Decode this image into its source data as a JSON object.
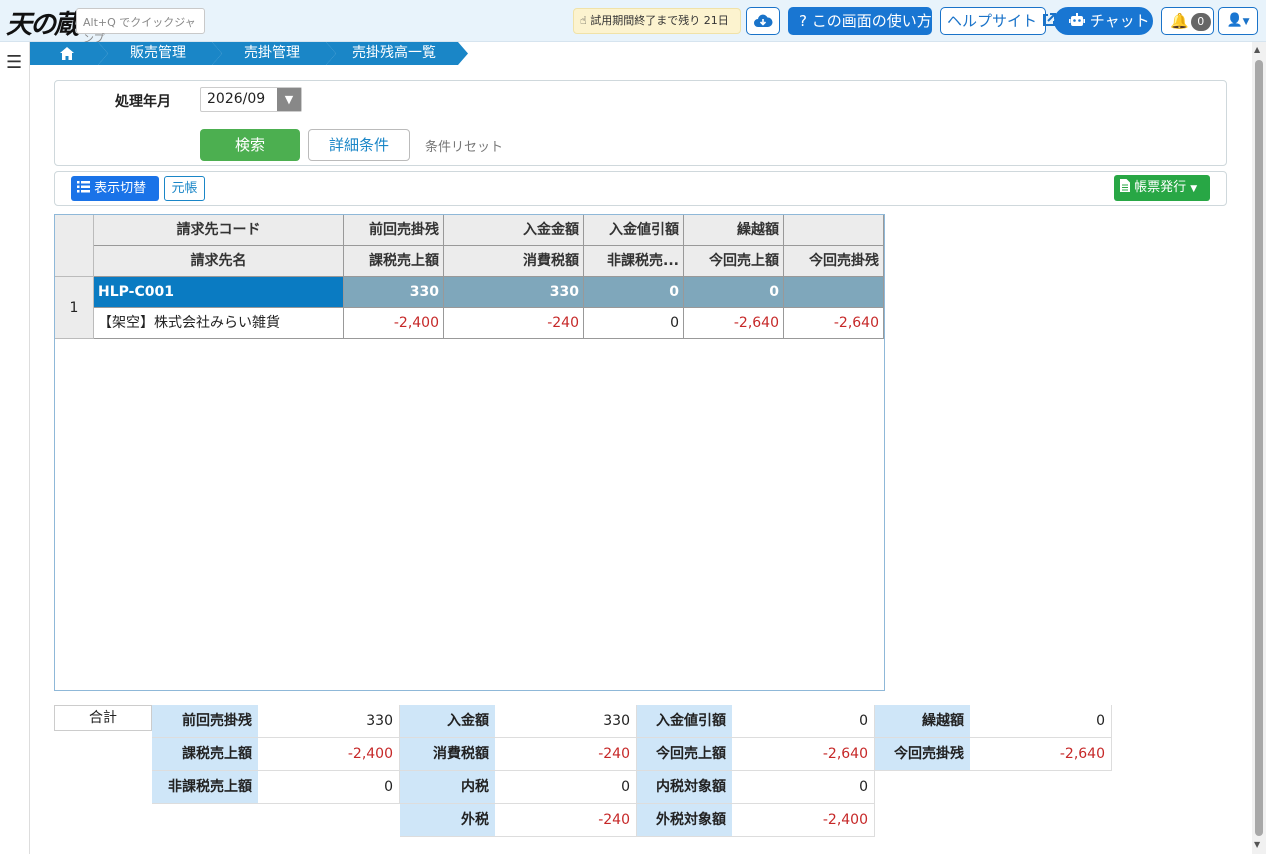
{
  "header": {
    "logo_text": "天の蔵",
    "quickjump_placeholder": "Alt+Q でクイックジャンプ",
    "trial_text": "試用期間終了まで残り 21日",
    "howto_label": "この画面の使い方",
    "help_label": "ヘルプサイト",
    "chat_label": "チャット",
    "notification_count": "0"
  },
  "breadcrumb": [
    "販売管理",
    "売掛管理",
    "売掛残高一覧"
  ],
  "search": {
    "year_month_label": "処理年月",
    "year_month_value": "2026/09",
    "search_button": "検索",
    "detail_button": "詳細条件",
    "reset_link": "条件リセット"
  },
  "toolbar": {
    "display_toggle": "表示切替",
    "ledger": "元帳",
    "report": "帳票発行"
  },
  "grid": {
    "header_row1": [
      "請求先コード",
      "前回売掛残",
      "入金金額",
      "入金値引額",
      "繰越額",
      ""
    ],
    "header_row2": [
      "請求先名",
      "課税売上額",
      "消費税額",
      "非課税売...",
      "今回売上額",
      "今回売掛残"
    ],
    "rows": [
      {
        "num": "1",
        "line1": [
          "HLP-C001",
          "330",
          "330",
          "0",
          "0",
          ""
        ],
        "line2": [
          "【架空】株式会社みらい雑貨",
          "-2,400",
          "-240",
          "0",
          "-2,640",
          "-2,640"
        ]
      }
    ]
  },
  "totals": {
    "label": "合計",
    "rows": [
      [
        [
          "前回売掛残",
          "330"
        ],
        [
          "入金額",
          "330"
        ],
        [
          "入金値引額",
          "0"
        ],
        [
          "繰越額",
          "0"
        ]
      ],
      [
        [
          "課税売上額",
          "-2,400"
        ],
        [
          "消費税額",
          "-240"
        ],
        [
          "今回売上額",
          "-2,640"
        ],
        [
          "今回売掛残",
          "-2,640"
        ]
      ],
      [
        [
          "非課税売上額",
          "0"
        ],
        [
          "内税",
          "0"
        ],
        [
          "内税対象額",
          "0"
        ]
      ],
      [
        [
          "",
          ""
        ],
        [
          "外税",
          "-240"
        ],
        [
          "外税対象額",
          "-2,400"
        ]
      ]
    ]
  }
}
